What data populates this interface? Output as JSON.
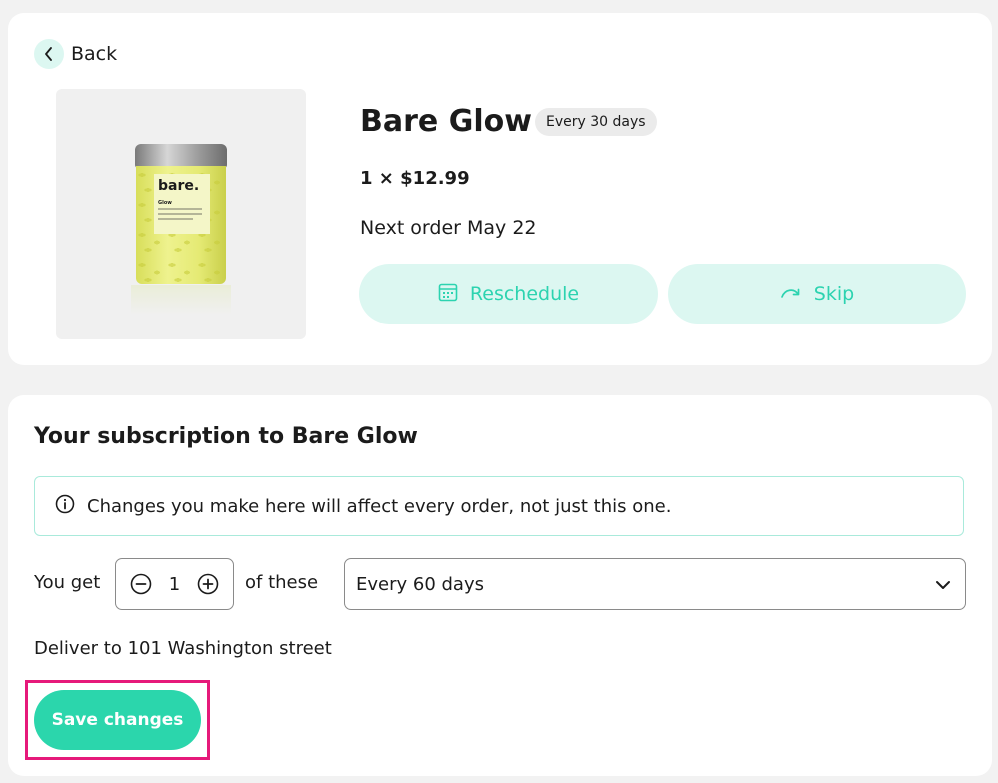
{
  "nav": {
    "back_label": "Back",
    "back_icon": "chevron-left-icon"
  },
  "product": {
    "title": "Bare Glow",
    "frequency_badge": "Every 30 days",
    "price_line": "1 × $12.99",
    "next_order": "Next order May 22",
    "image_brand": "bare.",
    "image_name": "Glow"
  },
  "actions": {
    "reschedule_label": "Reschedule",
    "reschedule_icon": "calendar-icon",
    "skip_label": "Skip",
    "skip_icon": "redo-arrow-icon"
  },
  "subscription": {
    "title": "Your subscription to Bare Glow",
    "info_text": "Changes you make here will affect every order, not just this one.",
    "info_icon": "info-icon",
    "you_get_label": "You get",
    "quantity": "1",
    "of_these_label": "of these",
    "frequency_selected": "Every 60 days",
    "deliver_to": "Deliver to 101 Washington street",
    "save_label": "Save changes"
  },
  "colors": {
    "accent": "#2bd6ac",
    "accent_light": "#dcf7f1",
    "highlight": "#e6197a",
    "background": "#f2f2f2"
  }
}
